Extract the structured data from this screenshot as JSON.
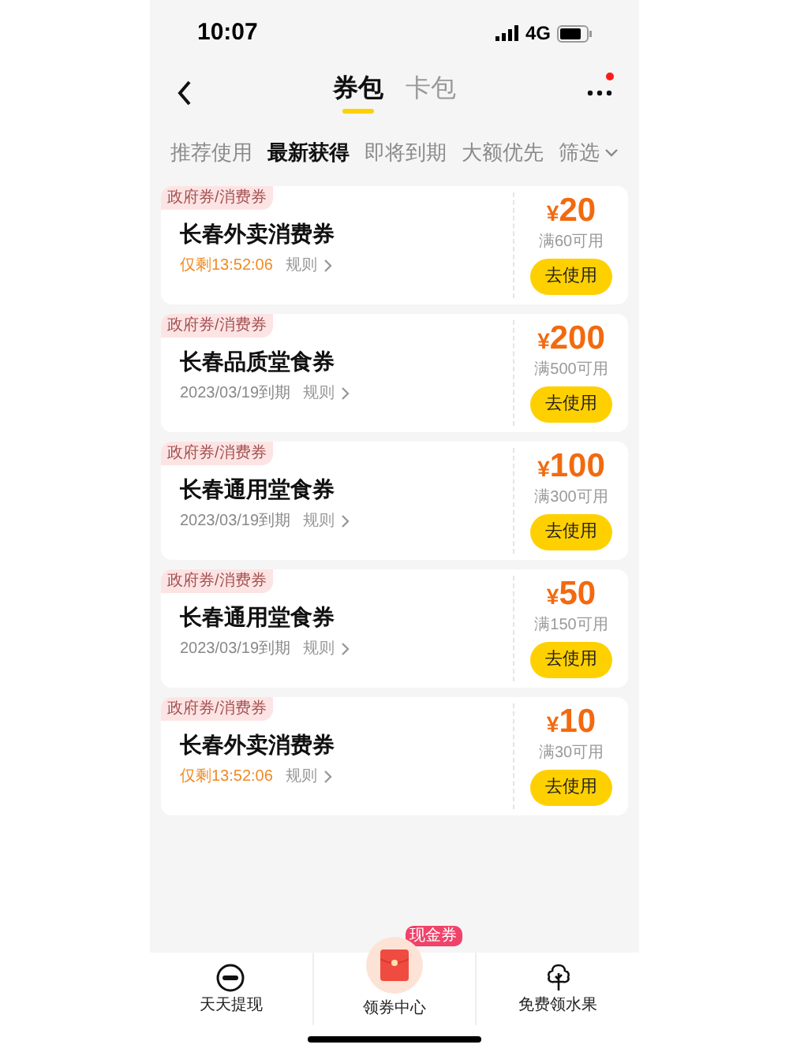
{
  "status_bar": {
    "time": "10:07",
    "network": "4G"
  },
  "header": {
    "tabs": [
      {
        "label": "券包",
        "selected": true
      },
      {
        "label": "卡包",
        "selected": false
      }
    ],
    "notification_dot": true
  },
  "filters": [
    {
      "label": "推荐使用",
      "selected": false
    },
    {
      "label": "最新获得",
      "selected": true
    },
    {
      "label": "即将到期",
      "selected": false
    },
    {
      "label": "大额优先",
      "selected": false
    },
    {
      "label": "筛选",
      "selected": false,
      "kind": "dropdown"
    }
  ],
  "coupons": [
    {
      "tag": "政府券/消费券",
      "title": "长春外卖消费券",
      "expiry": "仅剩13:52:06",
      "urgent": true,
      "rules": "规则",
      "currency": "¥",
      "amount": "20",
      "condition": "满60可用",
      "button": "去使用"
    },
    {
      "tag": "政府券/消费券",
      "title": "长春品质堂食券",
      "expiry": "2023/03/19到期",
      "urgent": false,
      "rules": "规则",
      "currency": "¥",
      "amount": "200",
      "condition": "满500可用",
      "button": "去使用"
    },
    {
      "tag": "政府券/消费券",
      "title": "长春通用堂食券",
      "expiry": "2023/03/19到期",
      "urgent": false,
      "rules": "规则",
      "currency": "¥",
      "amount": "100",
      "condition": "满300可用",
      "button": "去使用"
    },
    {
      "tag": "政府券/消费券",
      "title": "长春通用堂食券",
      "expiry": "2023/03/19到期",
      "urgent": false,
      "rules": "规则",
      "currency": "¥",
      "amount": "50",
      "condition": "满150可用",
      "button": "去使用"
    },
    {
      "tag": "政府券/消费券",
      "title": "长春外卖消费券",
      "expiry": "仅剩13:52:06",
      "urgent": true,
      "rules": "规则",
      "currency": "¥",
      "amount": "10",
      "condition": "满30可用",
      "button": "去使用"
    }
  ],
  "bottom_nav": [
    {
      "label": "天天提现",
      "kind": "coin"
    },
    {
      "label": "领券中心",
      "kind": "envelope",
      "badge": "现金券"
    },
    {
      "label": "免费领水果",
      "kind": "tree"
    }
  ]
}
